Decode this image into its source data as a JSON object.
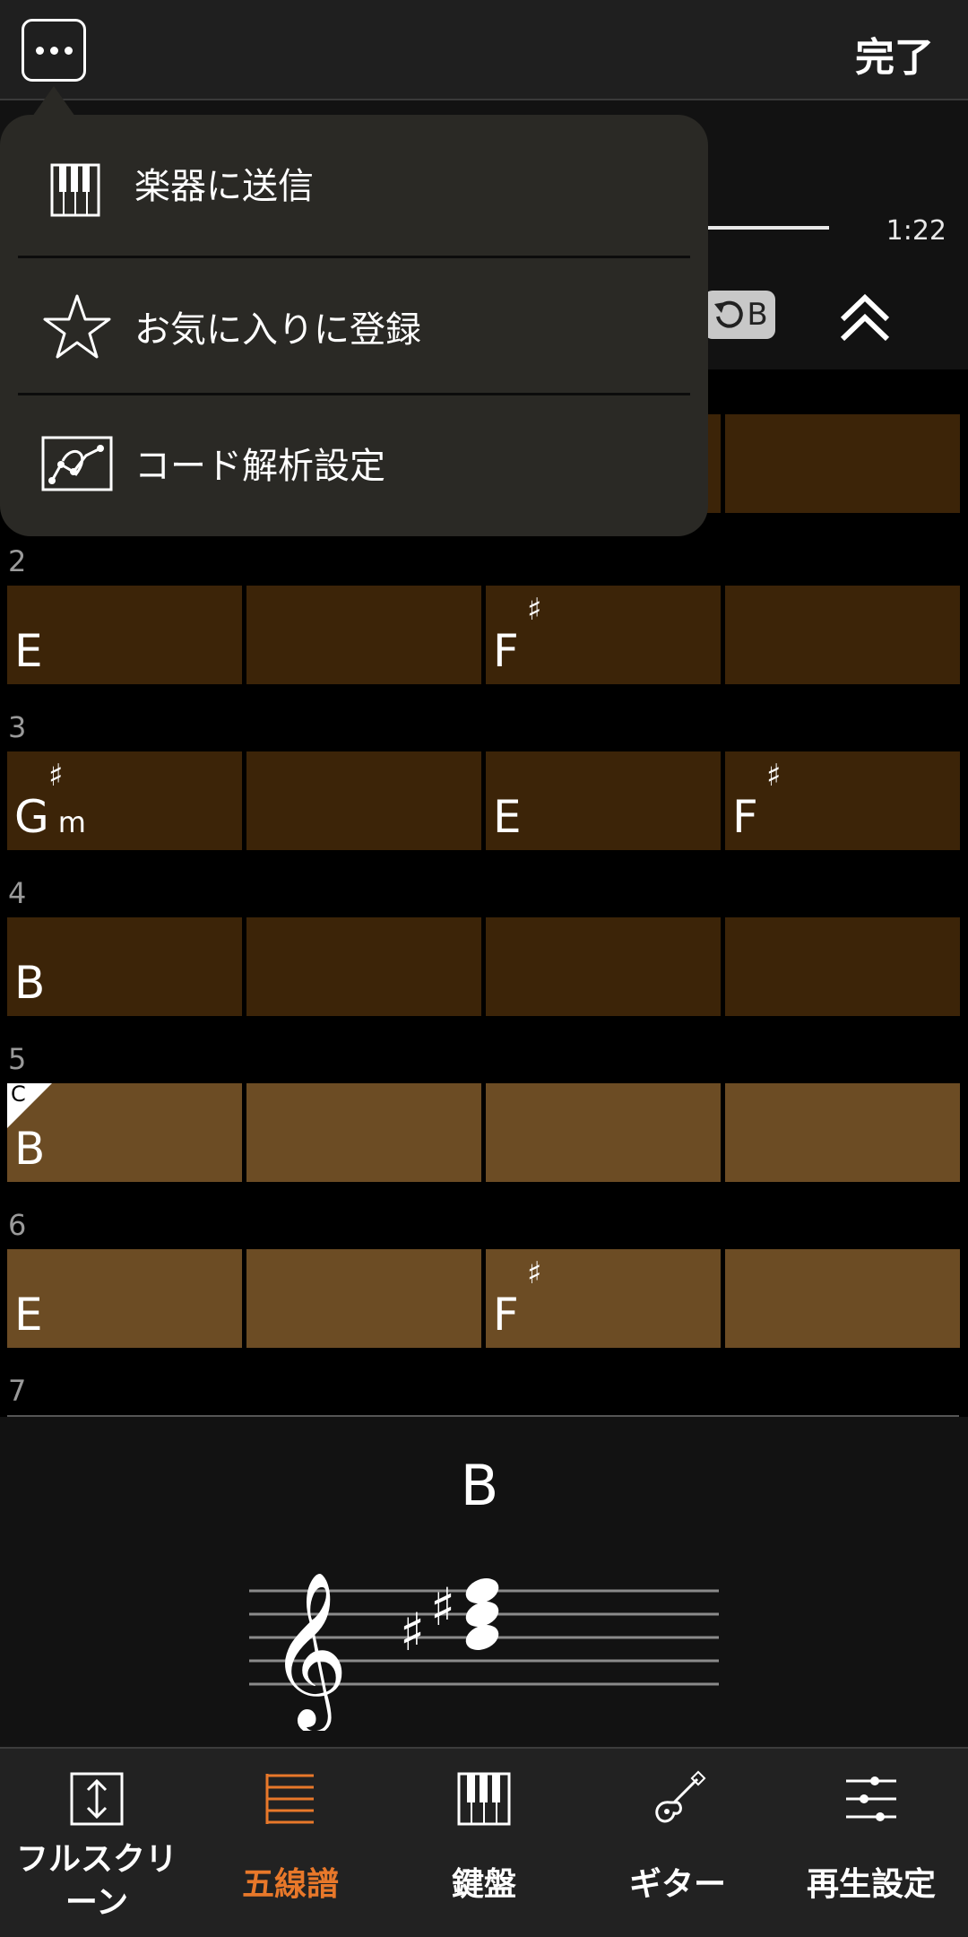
{
  "topbar": {
    "done_label": "完了"
  },
  "player": {
    "time": "1:22",
    "ab_label": "B"
  },
  "menu": {
    "items": [
      {
        "label": "楽器に送信",
        "icon": "keyboard-send-icon"
      },
      {
        "label": "お気に入りに登録",
        "icon": "star-icon"
      },
      {
        "label": "コード解析設定",
        "icon": "chord-analysis-icon"
      }
    ]
  },
  "bars": [
    {
      "num": "2",
      "chords": [
        {
          "root": "E",
          "acc": "",
          "qual": ""
        },
        {
          "root": "",
          "acc": "",
          "qual": ""
        },
        {
          "root": "F",
          "acc": "♯",
          "qual": ""
        },
        {
          "root": "",
          "acc": "",
          "qual": ""
        }
      ]
    },
    {
      "num": "3",
      "chords": [
        {
          "root": "G",
          "acc": "♯",
          "qual": "m"
        },
        {
          "root": "",
          "acc": "",
          "qual": ""
        },
        {
          "root": "E",
          "acc": "",
          "qual": ""
        },
        {
          "root": "F",
          "acc": "♯",
          "qual": ""
        }
      ]
    },
    {
      "num": "4",
      "chords": [
        {
          "root": "B",
          "acc": "",
          "qual": ""
        },
        {
          "root": "",
          "acc": "",
          "qual": ""
        },
        {
          "root": "",
          "acc": "",
          "qual": ""
        },
        {
          "root": "",
          "acc": "",
          "qual": ""
        }
      ]
    },
    {
      "num": "5",
      "marker": "C",
      "chords": [
        {
          "root": "B",
          "acc": "",
          "qual": ""
        },
        {
          "root": "",
          "acc": "",
          "qual": ""
        },
        {
          "root": "",
          "acc": "",
          "qual": ""
        },
        {
          "root": "",
          "acc": "",
          "qual": ""
        }
      ]
    },
    {
      "num": "6",
      "chords": [
        {
          "root": "E",
          "acc": "",
          "qual": ""
        },
        {
          "root": "",
          "acc": "",
          "qual": ""
        },
        {
          "root": "F",
          "acc": "♯",
          "qual": ""
        },
        {
          "root": "",
          "acc": "",
          "qual": ""
        }
      ]
    },
    {
      "num": "7"
    }
  ],
  "current_chord": {
    "name": "B"
  },
  "bottom_nav": [
    {
      "label": "フルスクリーン",
      "icon": "fullscreen-icon"
    },
    {
      "label": "五線譜",
      "icon": "staff-icon",
      "active": true
    },
    {
      "label": "鍵盤",
      "icon": "keyboard-icon"
    },
    {
      "label": "ギター",
      "icon": "guitar-icon"
    },
    {
      "label": "再生設定",
      "icon": "sliders-icon"
    }
  ],
  "colors": {
    "accent": "#e8782a",
    "cell_dark": "#3c2408",
    "cell_light": "#6c4c24"
  }
}
